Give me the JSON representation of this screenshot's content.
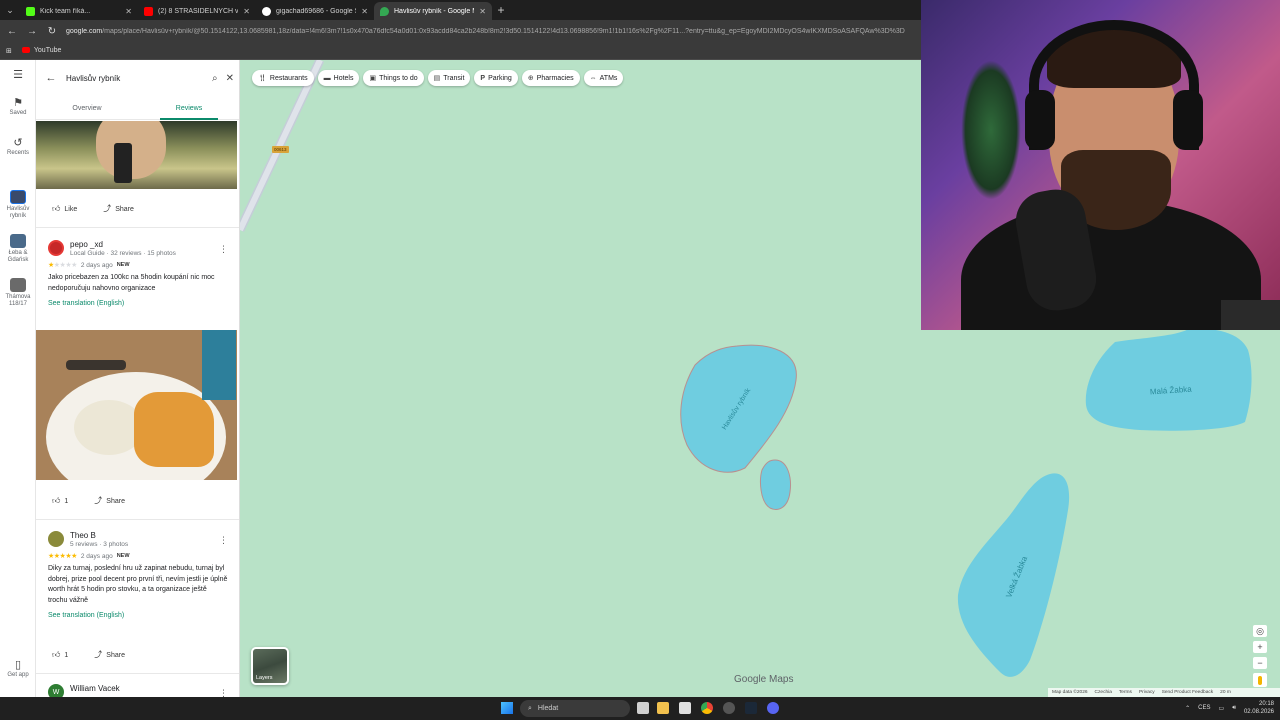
{
  "browser": {
    "tabs": [
      {
        "title": "Kick team říká...",
        "color": "#53fc18"
      },
      {
        "title": "(2) 8 STRAŠIDELNÝCH videí, po",
        "color": "#ff0000"
      },
      {
        "title": "gigachad69686 - Google Search",
        "color": "#ffffff"
      },
      {
        "title": "Havlisův rybník - Google Maps",
        "color": "#34a853"
      }
    ],
    "url_main": "google.com",
    "url_rest": "/maps/place/Havlisův+rybník/@50.1514122,13.0685981,18z/data=!4m6!3m7!1s0x470a76dfc54a0d01:0x93acdd84ca2b248b!8m2!3d50.1514122!4d13.0698856!9m1!1b1!16s%2Fg%2F11...?entry=ttu&g_ep=EgoyMDI2MDcyOS4wIKXMDSoASAFQAw%3D%3D",
    "bookmark": "YouTube"
  },
  "rail": {
    "saved": "Saved",
    "recents": "Recents",
    "recent_items": [
      "Havlisův rybník",
      "Łeba & Gdańsk",
      "Thámova 118/17"
    ],
    "get_app": "Get app"
  },
  "panel": {
    "search_value": "Havlisův rybník",
    "tab_overview": "Overview",
    "tab_reviews": "Reviews",
    "like": "Like",
    "share": "Share",
    "review1": {
      "name": "pepo _xd",
      "sub": "Local Guide · 32 reviews · 15 photos",
      "stars": 1,
      "date": "2 days ago",
      "badge": "NEW",
      "text": "Jako pricebazen za 100kc na 5hodin koupání nic moc nedoporučuju nahovno organizace",
      "translate": "See translation (English)",
      "like_count": "1",
      "share": "Share"
    },
    "review2": {
      "name": "Theo B",
      "sub": "5 reviews · 3 photos",
      "stars": 5,
      "date": "2 days ago",
      "badge": "NEW",
      "text": "Diky za turnaj, poslední hru už zapinat nebudu, turnaj byl dobrej, prize pool decent pro první tři, nevím jestli je úplně worth hrát 5 hodin pro stovku, a ta organizace ještě trochu vážně",
      "translate": "See translation (English)",
      "like_count": "1",
      "share": "Share"
    },
    "review3": {
      "name": "William Vacek",
      "initial": "W"
    }
  },
  "map": {
    "chips": [
      {
        "label": "Restaurants",
        "icon": "fork-knife-icon"
      },
      {
        "label": "Hotels",
        "icon": "bed-icon"
      },
      {
        "label": "Things to do",
        "icon": "camera-icon"
      },
      {
        "label": "Transit",
        "icon": "bus-icon"
      },
      {
        "label": "Parking",
        "icon": "parking-icon"
      },
      {
        "label": "Pharmacies",
        "icon": "pharmacy-icon"
      },
      {
        "label": "ATMs",
        "icon": "atm-icon"
      }
    ],
    "road_tag": "00613",
    "lakes": [
      "Havlisův rybník",
      "Malá Žabka",
      "Velká Žabka"
    ],
    "layers": "Layers",
    "watermark": "Google Maps",
    "footer": [
      "Map data ©2026",
      "Czechia",
      "Terms",
      "Privacy",
      "Send Product Feedback",
      "20 m"
    ]
  },
  "taskbar": {
    "search": "Hledat",
    "lang": "CES",
    "time": "20:18",
    "date": "02.08.2026"
  },
  "colors": {
    "accent": "#0b8a6b",
    "map_bg": "#b8e2c7",
    "water": "#6fcde0",
    "star": "#fbbc04"
  }
}
